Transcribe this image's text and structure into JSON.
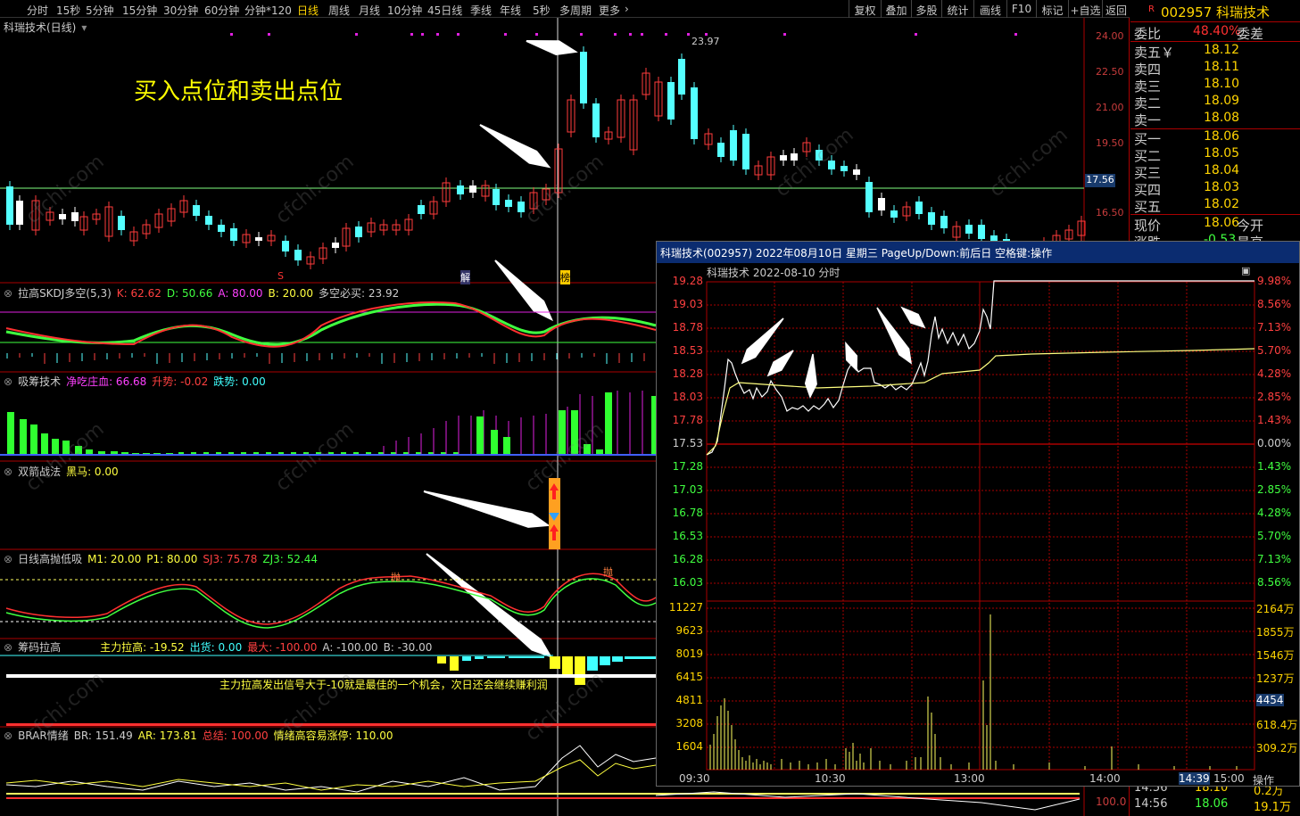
{
  "toolbar": {
    "periods": [
      "分时",
      "15秒",
      "5分钟",
      "15分钟",
      "30分钟",
      "60分钟",
      "分钟*120",
      "日线",
      "周线",
      "月线",
      "10分钟",
      "45日线",
      "季线",
      "年线",
      "5秒",
      "多周期",
      "更多"
    ],
    "active": "日线",
    "right_buttons": [
      "复权",
      "叠加",
      "多股",
      "统计",
      "画线",
      "F10",
      "标记",
      "+自选",
      "返回"
    ]
  },
  "chart_header": {
    "stock": "科瑞技术(日线)",
    "annotation": "买入点位和卖出点位",
    "high_label": "23.97"
  },
  "price_axis": [
    "24.00",
    "22.50",
    "21.00",
    "19.50",
    "17.56",
    "16.50"
  ],
  "markers": {
    "s": "S",
    "jie": "解",
    "bang": "榜"
  },
  "indicators": {
    "skdj": {
      "name": "拉高SKDJ多空(5,3)",
      "k": "K: 62.62",
      "d": "D: 50.66",
      "a": "A: 80.00",
      "b": "B: 20.00",
      "dk": "多空必买: 23.92"
    },
    "xichou": {
      "name": "吸筹技术",
      "jcz": "净吃庄血: 66.68",
      "sj": "升势: -0.02",
      "dj": "跌势: 0.00"
    },
    "shuangjian": {
      "name": "双箭战法",
      "hm": "黑马: 0.00"
    },
    "gaopao": {
      "name": "日线高抛低吸",
      "m1": "M1: 20.00",
      "p1": "P1: 80.00",
      "sj3": "SJ3: 75.78",
      "zj3": "ZJ3: 52.44",
      "pao1": "抛",
      "pao2": "抛"
    },
    "choumalagao": {
      "name": "筹码拉高",
      "zl": "主力拉高: -19.52",
      "ch": "出货: 0.00",
      "zd": "最大: -100.00",
      "a": "A: -100.00",
      "b": "B: -30.00",
      "note": "主力拉高发出信号大于-10就是最佳的一个机会，次日还会继续赚利润"
    },
    "brar": {
      "name": "BRAR情绪",
      "br": "BR: 151.49",
      "ar": "AR: 173.81",
      "zj": "总结: 100.00",
      "qx": "情绪高容易涨停: 110.00",
      "val": "100.0"
    }
  },
  "rightpanel": {
    "code": "002957 科瑞技术",
    "weibi_label": "委比",
    "weibi_val": "48.40%",
    "weicha_label": "委差",
    "sell": [
      {
        "l": "卖五￥",
        "v": "18.12"
      },
      {
        "l": "卖四",
        "v": "18.11"
      },
      {
        "l": "卖三",
        "v": "18.10"
      },
      {
        "l": "卖二",
        "v": "18.09"
      },
      {
        "l": "卖一",
        "v": "18.08"
      }
    ],
    "buy": [
      {
        "l": "买一",
        "v": "18.06"
      },
      {
        "l": "买二",
        "v": "18.05"
      },
      {
        "l": "买三",
        "v": "18.04"
      },
      {
        "l": "买四",
        "v": "18.03"
      },
      {
        "l": "买五",
        "v": "18.02"
      }
    ],
    "xianjia": {
      "l": "现价",
      "v": "18.06",
      "r": "今开"
    },
    "zhangdie": {
      "l": "涨跌",
      "v": "-0.53",
      "r": "最高"
    },
    "ticks": [
      {
        "t": "14:56",
        "p": "18.10",
        "v": "0.2万"
      },
      {
        "t": "14:56",
        "p": "18.06",
        "v": "19.1万"
      }
    ]
  },
  "popup": {
    "title": "科瑞技术(002957)  2022年08月10日  星期三  PageUp/Down:前后日  空格键:操作",
    "sub": "科瑞技术  2022-08-10 分时",
    "price_left": [
      "19.28",
      "19.03",
      "18.78",
      "18.53",
      "18.28",
      "18.03",
      "17.78",
      "17.53",
      "17.28",
      "17.03",
      "16.78",
      "16.53",
      "16.28",
      "16.03"
    ],
    "pct_right": [
      "9.98%",
      "8.56%",
      "7.13%",
      "5.70%",
      "4.28%",
      "2.85%",
      "1.43%",
      "0.00%",
      "1.43%",
      "2.85%",
      "4.28%",
      "5.70%",
      "7.13%",
      "8.56%"
    ],
    "vol_left": [
      "11227",
      "9623",
      "8019",
      "6415",
      "4811",
      "3208",
      "1604"
    ],
    "vol_right": [
      "2164万",
      "1855万",
      "1546万",
      "1237万",
      "4454",
      "618.4万",
      "309.2万"
    ],
    "xlabels": [
      "09:30",
      "10:30",
      "13:00",
      "14:00",
      "14:39",
      "15:00"
    ],
    "op": "操作"
  },
  "watermark": "cfchi.com"
}
